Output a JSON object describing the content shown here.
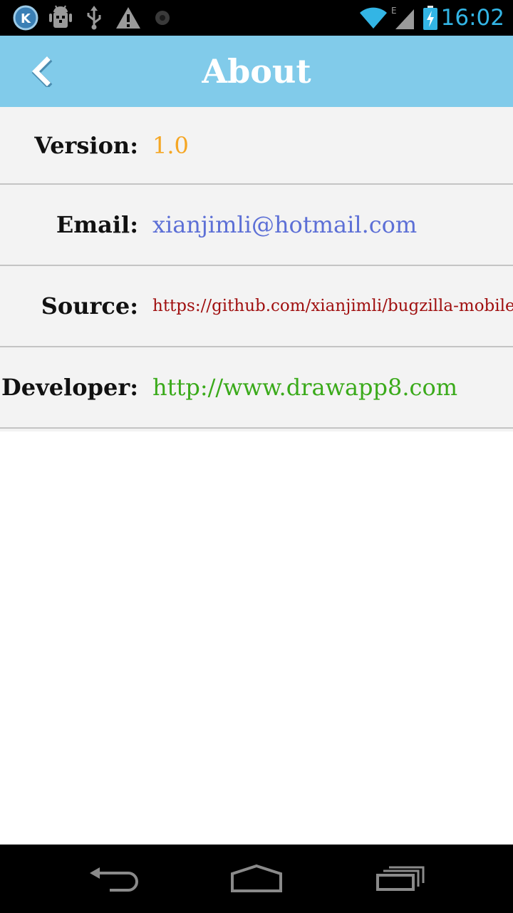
{
  "status_bar": {
    "time": "16:02",
    "icons": [
      "k-app-icon",
      "android-debug-icon",
      "usb-icon",
      "warning-icon",
      "record-icon",
      "wifi-icon",
      "signal-e-icon",
      "battery-charging-icon"
    ],
    "network_type": "E"
  },
  "header": {
    "title": "About",
    "back_icon": "chevron-left-icon",
    "background": "#81cbea"
  },
  "info": {
    "rows": [
      {
        "label": "Version:",
        "value": "1.0",
        "color": "#f5a623"
      },
      {
        "label": "Email:",
        "value": "xianjimli@hotmail.com",
        "color": "#5c6fd6"
      },
      {
        "label": "Source:",
        "value": "https://github.com/xianjimli/bugzilla-mobile",
        "color": "#a01010"
      },
      {
        "label": "Developer:",
        "value": "http://www.drawapp8.com",
        "color": "#3aaa1a"
      }
    ]
  },
  "nav_bar": {
    "icons": [
      "back-icon",
      "home-icon",
      "recent-apps-icon"
    ]
  }
}
